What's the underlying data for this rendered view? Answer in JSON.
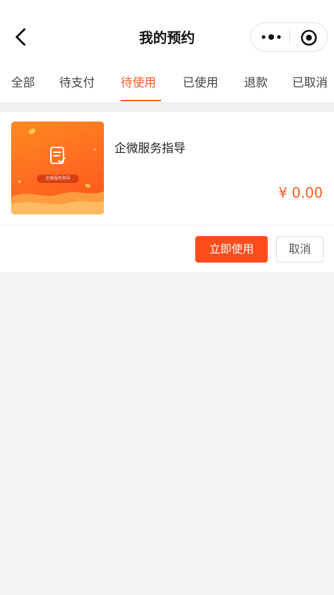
{
  "header": {
    "title": "我的预约"
  },
  "tabs": [
    {
      "label": "全部",
      "active": false
    },
    {
      "label": "待支付",
      "active": false
    },
    {
      "label": "待使用",
      "active": true
    },
    {
      "label": "已使用",
      "active": false
    },
    {
      "label": "退款",
      "active": false
    },
    {
      "label": "已取消",
      "active": false
    }
  ],
  "orders": [
    {
      "title": "企微服务指导",
      "thumbnail_caption": "企微服务指导",
      "price": "¥ 0.00",
      "actions": {
        "use_label": "立即使用",
        "cancel_label": "取消"
      }
    }
  ],
  "colors": {
    "accent": "#ff5a24",
    "button": "#ff4d1c"
  },
  "icons": {
    "back": "back-arrow-icon",
    "more": "more-dots-icon",
    "close_target": "target-circle-icon",
    "document": "document-check-icon"
  }
}
